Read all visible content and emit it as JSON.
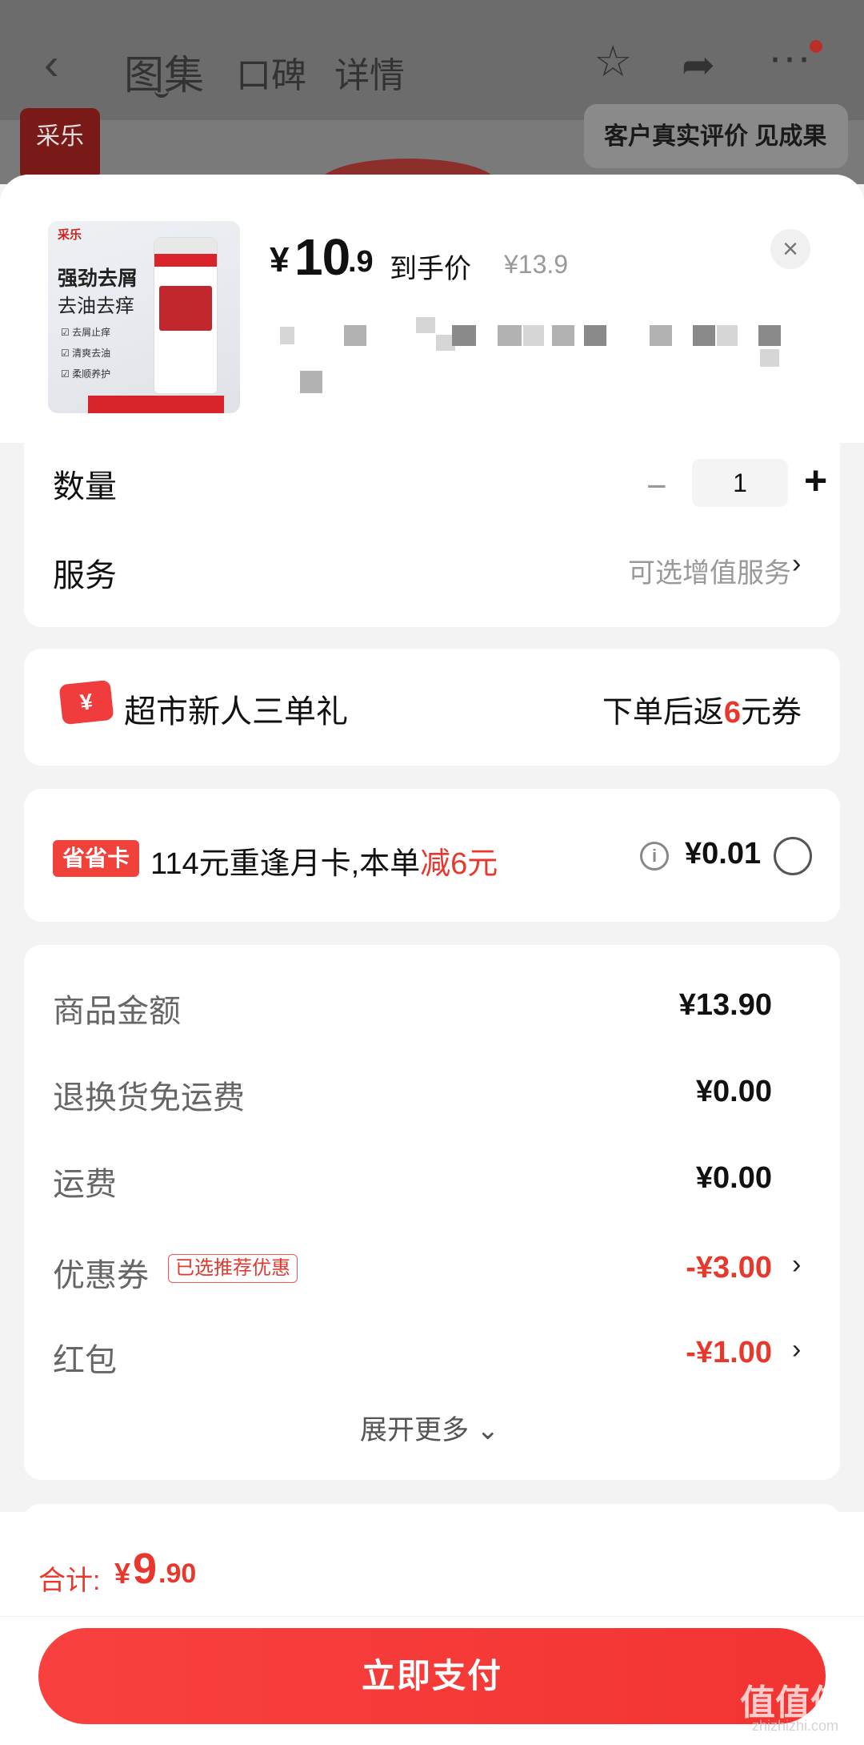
{
  "background": {
    "tabs": [
      "图集",
      "口碑",
      "详情"
    ],
    "banner_text": "客户真实评价 见成果",
    "logo_text": "采乐"
  },
  "product": {
    "thumb_logo": "采乐",
    "thumb_line1": "强劲去屑",
    "thumb_line2": "去油去痒",
    "thumb_checks": [
      "☑ 去屑止痒",
      "☑ 清爽去油",
      "☑ 柔顺养护"
    ],
    "price_symbol": "¥",
    "price_int": "10",
    "price_dec": ".9",
    "price_tag": "到手价",
    "original_price": "¥13.9",
    "close_icon": "×"
  },
  "quantity": {
    "label": "数量",
    "minus": "−",
    "value": "1",
    "plus": "+"
  },
  "service": {
    "label": "服务",
    "option": "可选增值服务",
    "chevron": "›"
  },
  "gift": {
    "icon": "¥",
    "title": "超市新人三单礼",
    "note_prefix": "下单后返",
    "note_amount": "6",
    "note_suffix": "元券"
  },
  "card_offer": {
    "badge": "省省卡",
    "text": "114元重逢月卡,本单",
    "text_red": "减6元",
    "info_icon": "i",
    "price": "¥0.01"
  },
  "summary": {
    "rows": [
      {
        "label": "商品金额",
        "value": "¥13.90"
      },
      {
        "label": "退换货免运费",
        "value": "¥0.00"
      },
      {
        "label": "运费",
        "value": "¥0.00"
      },
      {
        "label": "优惠券",
        "value": "-¥3.00",
        "tag": "已选推荐优惠"
      },
      {
        "label": "红包",
        "value": "-¥1.00"
      }
    ],
    "expand": "展开更多 ⌄"
  },
  "footer": {
    "total_label": "合计:",
    "total_sym": "¥",
    "total_int": "9",
    "total_dec": ".90",
    "pay_button": "立即支付"
  },
  "watermark": {
    "main": "值值值",
    "sub": "zhizhizhi.com"
  },
  "colors": {
    "accent": "#e8372c",
    "button": "#f23432"
  }
}
